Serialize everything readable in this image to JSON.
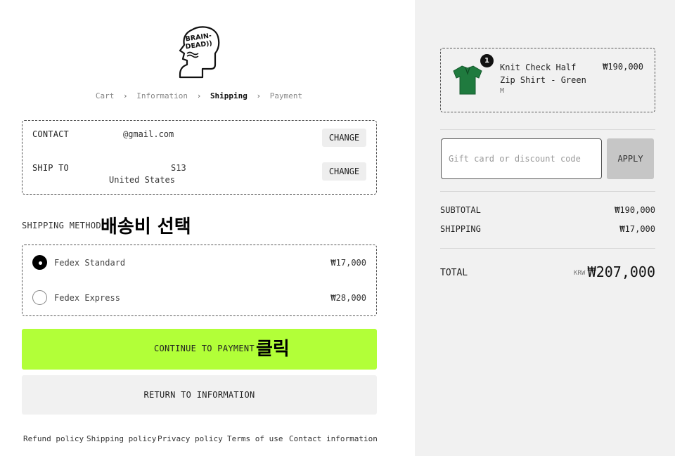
{
  "brand": {
    "logo_text": "BRAIN-DEAD))"
  },
  "breadcrumb": {
    "items": [
      "Cart",
      "Information",
      "Shipping",
      "Payment"
    ],
    "active": "Shipping"
  },
  "contact": {
    "label": "CONTACT",
    "value": "@gmail.com",
    "change_label": "CHANGE"
  },
  "ship_to": {
    "label": "SHIP TO",
    "line1": "S13",
    "line2": "United States",
    "change_label": "CHANGE"
  },
  "shipping_method": {
    "title": "SHIPPING METHOD",
    "annotation": "배송비 선택",
    "options": [
      {
        "name": "Fedex Standard",
        "price": "₩17,000",
        "selected": true
      },
      {
        "name": "Fedex Express",
        "price": "₩28,000",
        "selected": false
      }
    ]
  },
  "actions": {
    "continue_label": "CONTINUE TO PAYMENT",
    "continue_annotation": "클릭",
    "continue_color": "#b2ff38",
    "return_label": "RETURN TO INFORMATION"
  },
  "footer": {
    "links": [
      "Refund policy",
      "Shipping policy",
      "Privacy policy",
      "Terms of use",
      "Contact information"
    ]
  },
  "order_summary": {
    "product": {
      "name": "Knit Check Half Zip Shirt - Green",
      "variant": "M",
      "price": "₩190,000",
      "quantity": "1",
      "thumbnail_color": "#1f7a3e"
    },
    "discount": {
      "placeholder": "Gift card or discount code",
      "value": "",
      "apply_label": "APPLY"
    },
    "subtotal_label": "SUBTOTAL",
    "subtotal_value": "₩190,000",
    "shipping_label": "SHIPPING",
    "shipping_value": "₩17,000",
    "total_label": "TOTAL",
    "currency": "KRW",
    "total_value": "₩207,000"
  }
}
